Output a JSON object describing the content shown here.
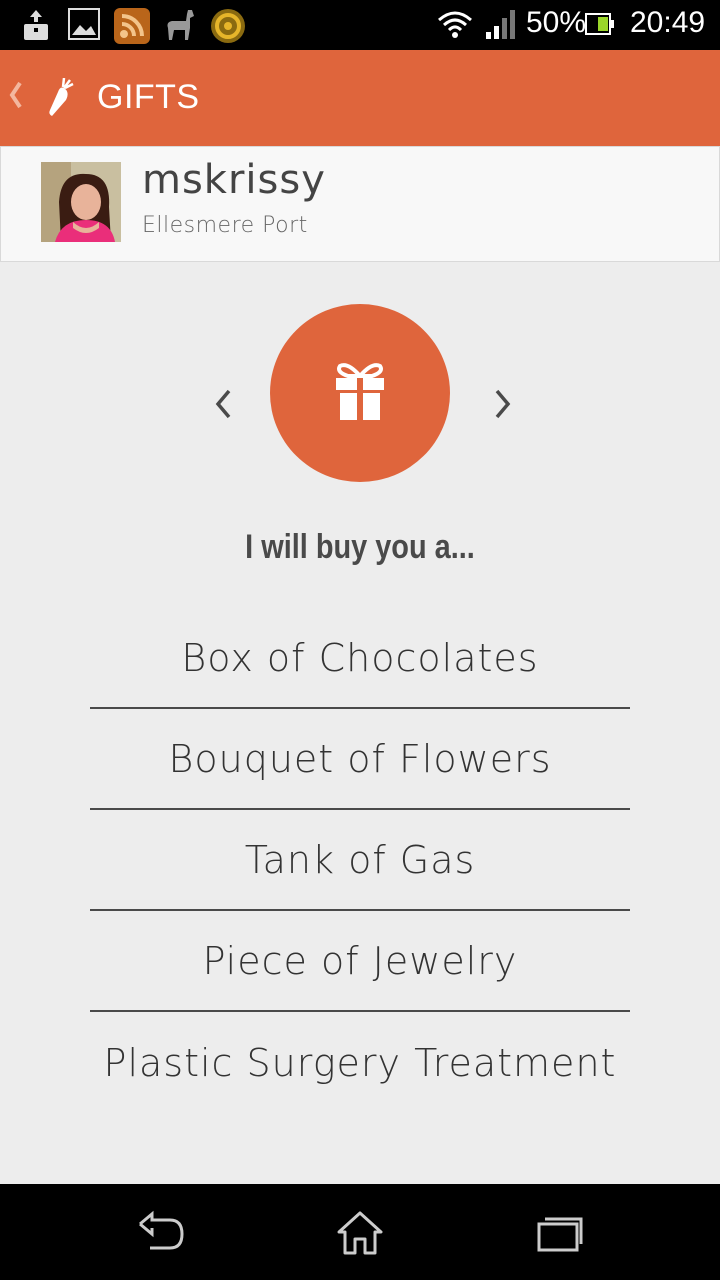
{
  "status_bar": {
    "battery": "50%",
    "time": "20:49",
    "icons": [
      "download-notification-icon",
      "image-notification-icon",
      "rss-app-icon",
      "llama-app-icon",
      "circle-app-icon",
      "wifi-icon",
      "signal-icon",
      "battery-icon"
    ]
  },
  "header": {
    "title": "GIFTS",
    "back_icon": "chevron-left-icon",
    "logo_icon": "carrot-icon"
  },
  "profile": {
    "username": "mskrissy",
    "location": "Ellesmere Port"
  },
  "carousel": {
    "icon": "gift-icon",
    "prev_icon": "chevron-left-icon",
    "next_icon": "chevron-right-icon"
  },
  "prompt": "I will buy you a...",
  "gifts": [
    "Box of Chocolates",
    "Bouquet of Flowers",
    "Tank of Gas",
    "Piece of Jewelry",
    "Plastic Surgery Treatment"
  ],
  "nav_bar": [
    "back-icon",
    "home-icon",
    "recents-icon"
  ],
  "colors": {
    "accent": "#df653c",
    "background": "#ededed",
    "text": "#333333"
  }
}
